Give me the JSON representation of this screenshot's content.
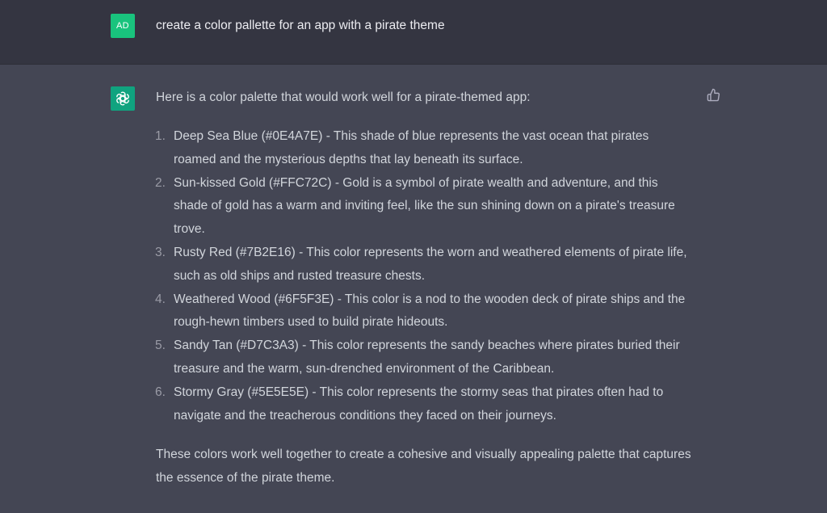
{
  "user_message": {
    "avatar_initials": "AD",
    "text": "create a color pallette for an app with a pirate theme"
  },
  "assistant_message": {
    "avatar_icon": "openai-logo-icon",
    "feedback_icon": "thumbs-up-icon",
    "intro": "Here is a color palette that would work well for a pirate-themed app:",
    "items": [
      {
        "number": "1.",
        "text": "Deep Sea Blue (#0E4A7E) - This shade of blue represents the vast ocean that pirates roamed and the mysterious depths that lay beneath its surface."
      },
      {
        "number": "2.",
        "text": "Sun-kissed Gold (#FFC72C) - Gold is a symbol of pirate wealth and adventure, and this shade of gold has a warm and inviting feel, like the sun shining down on a pirate's treasure trove."
      },
      {
        "number": "3.",
        "text": "Rusty Red (#7B2E16) - This color represents the worn and weathered elements of pirate life, such as old ships and rusted treasure chests."
      },
      {
        "number": "4.",
        "text": "Weathered Wood (#6F5F3E) - This color is a nod to the wooden deck of pirate ships and the rough-hewn timbers used to build pirate hideouts."
      },
      {
        "number": "5.",
        "text": "Sandy Tan (#D7C3A3) - This color represents the sandy beaches where pirates buried their treasure and the warm, sun-drenched environment of the Caribbean."
      },
      {
        "number": "6.",
        "text": "Stormy Gray (#5E5E5E) - This color represents the stormy seas that pirates often had to navigate and the treacherous conditions they faced on their journeys."
      }
    ],
    "closing": "These colors work well together to create a cohesive and visually appealing palette that captures the essence of the pirate theme."
  },
  "colors": {
    "user_row_bg": "#343541",
    "assistant_row_bg": "#444654",
    "user_avatar_bg": "#19c37d",
    "bot_avatar_bg": "#10a37f",
    "text": "#d1d5db"
  }
}
